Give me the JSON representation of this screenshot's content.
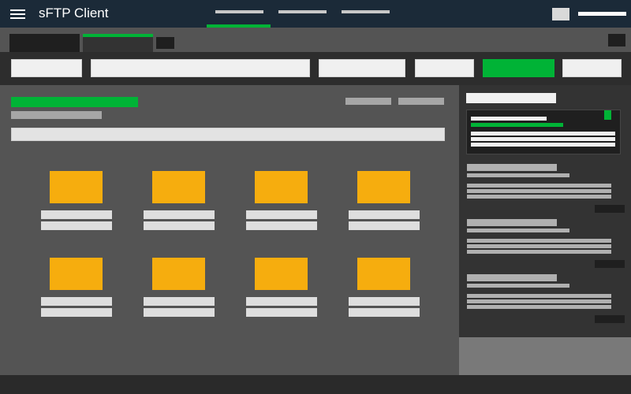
{
  "app": {
    "title": "sFTP Client"
  },
  "icons": {
    "menu": "hamburger-menu-icon"
  },
  "colors": {
    "topbar": "#1b2a38",
    "accent": "#00b336",
    "folder": "#f6ad0e",
    "background": "#545454",
    "panel": "#333333"
  },
  "nav": {
    "active_tab": 0,
    "tab_count": 3
  },
  "tabs": {
    "active_tab": 1,
    "tab_count": 3
  },
  "toolbar": {
    "active_button": 4,
    "button_count": 6
  },
  "folders": {
    "count": 8
  },
  "side_panel": {
    "item_count": 3
  }
}
